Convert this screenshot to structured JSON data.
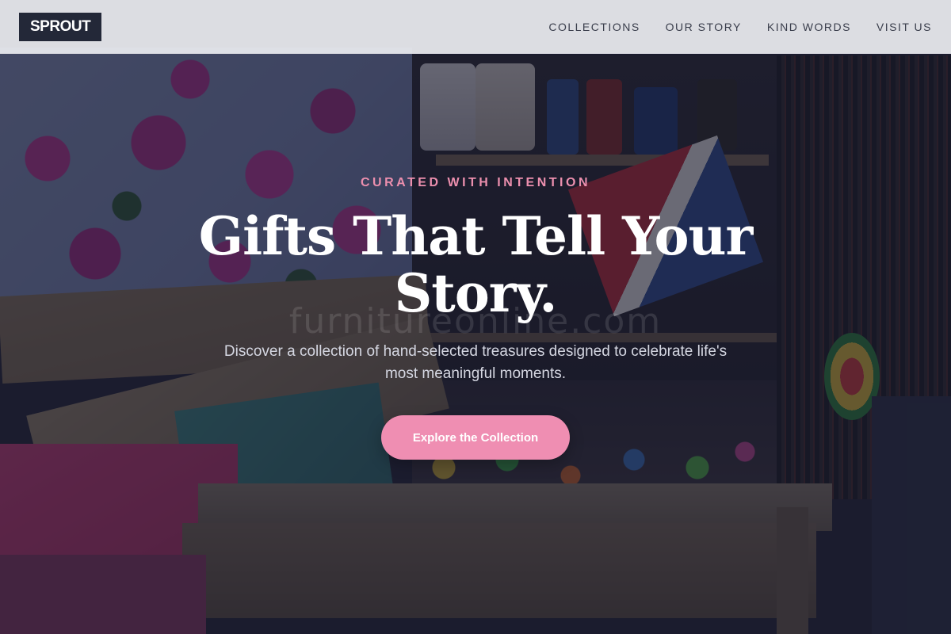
{
  "brand": {
    "logo_text": "SPROUT"
  },
  "nav": {
    "items": [
      {
        "label": "COLLECTIONS"
      },
      {
        "label": "OUR STORY"
      },
      {
        "label": "KIND WORDS"
      },
      {
        "label": "VISIT US"
      }
    ]
  },
  "hero": {
    "eyebrow": "CURATED WITH INTENTION",
    "headline": "Gifts That Tell Your Story.",
    "subtext": "Discover a collection of hand-selected treasures designed to celebrate life's most meaningful moments.",
    "cta_label": "Explore the Collection",
    "watermark": "furnitureonline.com"
  },
  "colors": {
    "accent": "#ef8eb2",
    "eyebrow": "#ec8fae",
    "logo_bg": "#232838",
    "nav_text": "#3a3e4c"
  }
}
